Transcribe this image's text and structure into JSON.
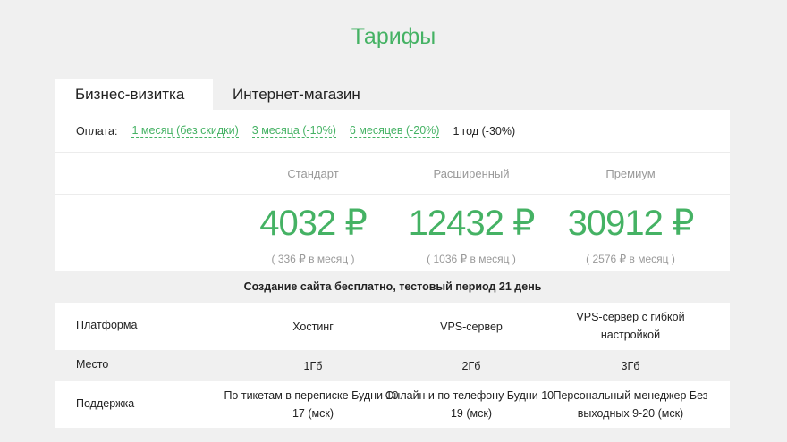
{
  "page": {
    "title": "Тарифы"
  },
  "tabs": [
    {
      "label": "Бизнес-визитка",
      "active": true
    },
    {
      "label": "Интернет-магазин",
      "active": false
    }
  ],
  "payment": {
    "label": "Оплата:",
    "options": [
      {
        "label": "1 месяц (без скидки)",
        "selected": false
      },
      {
        "label": "3 месяца (-10%)",
        "selected": false
      },
      {
        "label": "6 месяцев (-20%)",
        "selected": false
      },
      {
        "label": "1 год (-30%)",
        "selected": true
      }
    ]
  },
  "plans": [
    {
      "name": "Стандарт",
      "price": "4032 ₽",
      "monthly": "( 336 ₽ в месяц )"
    },
    {
      "name": "Расширенный",
      "price": "12432 ₽",
      "monthly": "( 1036 ₽ в месяц )"
    },
    {
      "name": "Премиум",
      "price": "30912 ₽",
      "monthly": "( 2576 ₽ в месяц )"
    }
  ],
  "note": "Создание сайта бесплатно, тестовый период 21 день",
  "features": [
    {
      "label": "Платформа",
      "values": [
        "Хостинг",
        "VPS-сервер",
        "VPS-сервер с гибкой настройкой"
      ]
    },
    {
      "label": "Место",
      "values": [
        "1Гб",
        "2Гб",
        "3Гб"
      ]
    },
    {
      "label": "Поддержка",
      "values": [
        "По тикетам в переписке Будни 10-17 (мск)",
        "Онлайн и по телефону Будни 10-19 (мск)",
        "Персональный менеджер Без выходных 9-20 (мск)"
      ]
    }
  ],
  "colors": {
    "accent": "#45b264",
    "background": "#f0f0f0",
    "muted": "#999999"
  }
}
